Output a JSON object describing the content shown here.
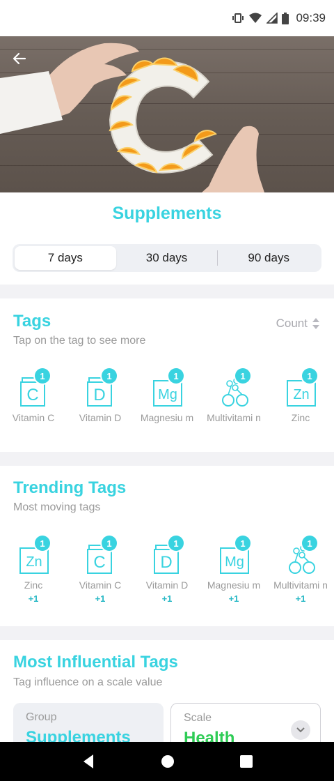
{
  "status": {
    "time": "09:39"
  },
  "page": {
    "title": "Supplements"
  },
  "periods": [
    "7 days",
    "30 days",
    "90 days"
  ],
  "tags_card": {
    "title": "Tags",
    "subtitle": "Tap on the tag to see more",
    "sort_label": "Count",
    "items": [
      {
        "icon": "vitamin-c-icon",
        "label": "Vitamin C",
        "count": "1"
      },
      {
        "icon": "vitamin-d-icon",
        "label": "Vitamin D",
        "count": "1"
      },
      {
        "icon": "magnesium-icon",
        "label": "Magnesiu m",
        "count": "1"
      },
      {
        "icon": "multivitamin-icon",
        "label": "Multivitami n",
        "count": "1"
      },
      {
        "icon": "zinc-icon",
        "label": "Zinc",
        "count": "1"
      }
    ]
  },
  "trending_card": {
    "title": "Trending Tags",
    "subtitle": "Most moving tags",
    "items": [
      {
        "icon": "zinc-icon",
        "label": "Zinc",
        "count": "1",
        "delta": "+1"
      },
      {
        "icon": "vitamin-c-icon",
        "label": "Vitamin C",
        "count": "1",
        "delta": "+1"
      },
      {
        "icon": "vitamin-d-icon",
        "label": "Vitamin D",
        "count": "1",
        "delta": "+1"
      },
      {
        "icon": "magnesium-icon",
        "label": "Magnesiu m",
        "count": "1",
        "delta": "+1"
      },
      {
        "icon": "multivitamin-icon",
        "label": "Multivitami n",
        "count": "1",
        "delta": "+1"
      }
    ]
  },
  "influential_card": {
    "title": "Most Influential Tags",
    "subtitle": "Tag influence on a scale value",
    "group_label": "Group",
    "group_value": "Supplements",
    "scale_label": "Scale",
    "scale_value": "Health"
  },
  "colors": {
    "accent": "#39d3e0",
    "health": "#2ecc55"
  }
}
